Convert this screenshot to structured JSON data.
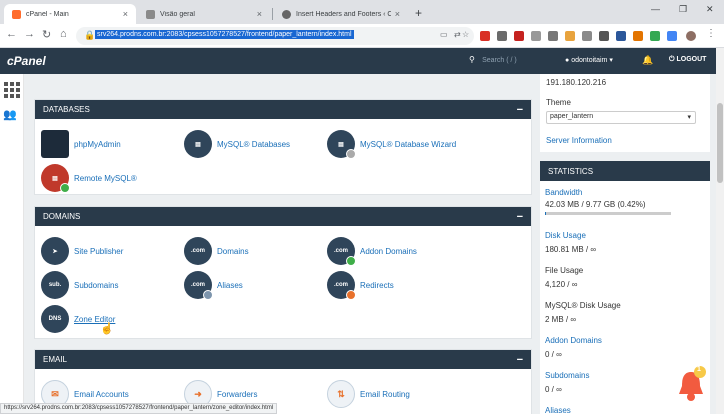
{
  "browser": {
    "tabs": [
      {
        "title": "cPanel - Main",
        "color": "#ff6c2c"
      },
      {
        "title": "Visão geral",
        "color": "#8a8a8a"
      },
      {
        "title": "Insert Headers and Footers ‹ Odo",
        "color": "#666"
      }
    ],
    "close_glyph": "×",
    "new_tab_glyph": "+",
    "window_controls": [
      "—",
      "❐",
      "✕"
    ],
    "url": "srv264.prodns.com.br:2083/cpsess1057278527/frontend/paper_lantern/index.html"
  },
  "cpanel": {
    "logo": "cPanel",
    "search_placeholder": "Search ( / )",
    "username": "odontoitaim",
    "logout": "LOGOUT"
  },
  "sections": {
    "databases": {
      "title": "DATABASES",
      "items": [
        "phpMyAdmin",
        "MySQL® Databases",
        "MySQL® Database Wizard",
        "Remote MySQL®"
      ]
    },
    "domains": {
      "title": "DOMAINS",
      "items": [
        "Site Publisher",
        "Domains",
        "Addon Domains",
        "Subdomains",
        "Aliases",
        "Redirects",
        "Zone Editor"
      ],
      "icon_text": {
        "dotcom": ".com",
        "sub": "sub.",
        "dns": "DNS"
      }
    },
    "email": {
      "title": "EMAIL",
      "items": [
        "Email Accounts",
        "Forwarders",
        "Email Routing"
      ]
    }
  },
  "right": {
    "ip": "191.180.120.216",
    "theme_label": "Theme",
    "theme_value": "paper_lantern",
    "server_info": "Server Information",
    "statistics_title": "STATISTICS",
    "stats": [
      {
        "label": "Bandwidth",
        "value": "42.03 MB / 9.77 GB  (0.42%)",
        "fraction": 0.0042
      },
      {
        "label": "Disk Usage",
        "value": "180.81 MB / ∞"
      },
      {
        "label": "File Usage",
        "value": "4,120 / ∞"
      },
      {
        "label": "MySQL® Disk Usage",
        "value": "2 MB / ∞"
      },
      {
        "label": "Addon Domains",
        "value": "0 / ∞"
      },
      {
        "label": "Subdomains",
        "value": "0 / ∞"
      },
      {
        "label": "Aliases",
        "value": ""
      }
    ]
  },
  "status_url": "https://srv264.prodns.com.br:2083/cpsess1057278527/frontend/paper_lantern/zone_editor/index.html",
  "notification_count": "1"
}
